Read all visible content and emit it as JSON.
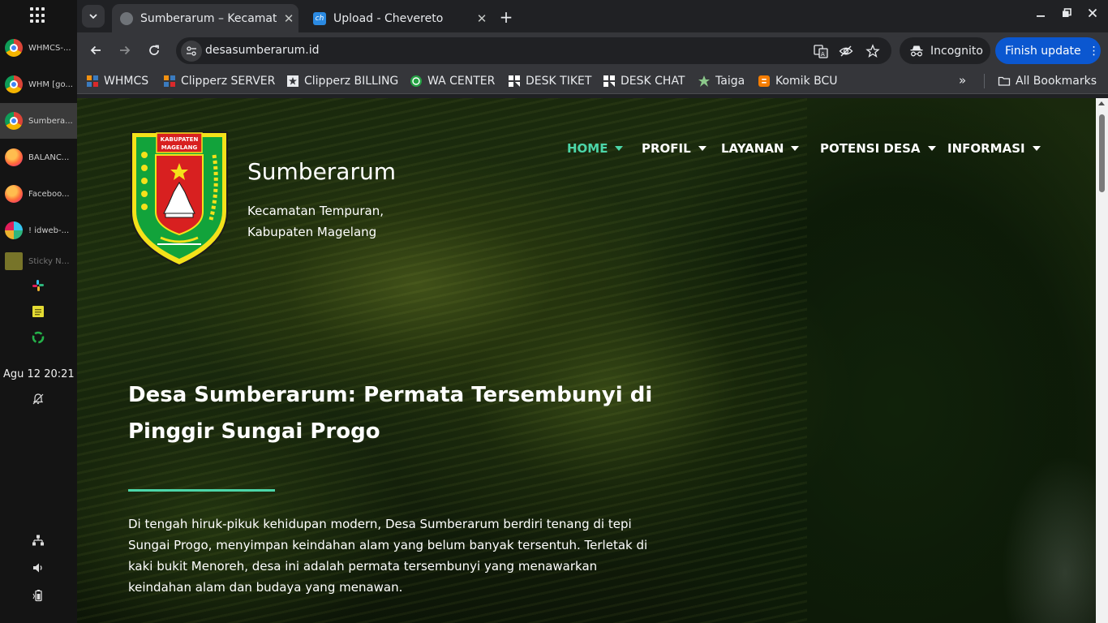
{
  "dock": {
    "windows": [
      {
        "label": "WHMCS-...",
        "icon": "chrome-icon"
      },
      {
        "label": "WHM [go...",
        "icon": "chrome-icon"
      },
      {
        "label": "Sumbera...",
        "icon": "chrome-icon"
      },
      {
        "label": "BALANC...",
        "icon": "firefox-icon"
      },
      {
        "label": "Faceboo...",
        "icon": "firefox-icon"
      },
      {
        "label": "! idweb-...",
        "icon": "slack-icon"
      },
      {
        "label": "Sticky No...",
        "icon": "sticky-notes-icon"
      }
    ],
    "clock": "Agu 12  20:21"
  },
  "browser": {
    "tabs": [
      {
        "title": "Sumberarum – Kecamatan Tempuran",
        "active": true
      },
      {
        "title": "Upload - Chevereto",
        "active": false
      }
    ],
    "new_tab": "+",
    "url": "desasumberarum.id",
    "incognito_label": "Incognito",
    "update_label": "Finish update",
    "bookmarks": [
      {
        "label": "WHMCS"
      },
      {
        "label": "Clipperz SERVER"
      },
      {
        "label": "Clipperz BILLING"
      },
      {
        "label": "WA CENTER"
      },
      {
        "label": "DESK TIKET"
      },
      {
        "label": "DESK CHAT"
      },
      {
        "label": "Taiga"
      },
      {
        "label": "Komik BCU"
      }
    ],
    "bookmarks_more": "»",
    "all_bookmarks": "All Bookmarks"
  },
  "site": {
    "logo_text": "KABUPATEN MAGELANG",
    "name": "Sumberarum",
    "subtitle_line1": "Kecamatan Tempuran,",
    "subtitle_line2": "Kabupaten Magelang",
    "nav": [
      {
        "label": "HOME",
        "current": true
      },
      {
        "label": "PROFIL"
      },
      {
        "label": "LAYANAN"
      },
      {
        "label": "POTENSI DESA"
      },
      {
        "label": "INFORMASI"
      }
    ],
    "hero_title": "Desa Sumberarum: Permata Tersembunyi di Pinggir Sungai Progo",
    "hero_text": "Di tengah hiruk-pikuk kehidupan modern, Desa Sumberarum berdiri tenang di tepi Sungai Progo, menyimpan keindahan alam yang belum banyak tersentuh. Terletak di kaki bukit Menoreh, desa ini adalah permata tersembunyi yang menawarkan keindahan alam dan budaya yang menawan.",
    "accent_color": "#4cd6a9"
  }
}
